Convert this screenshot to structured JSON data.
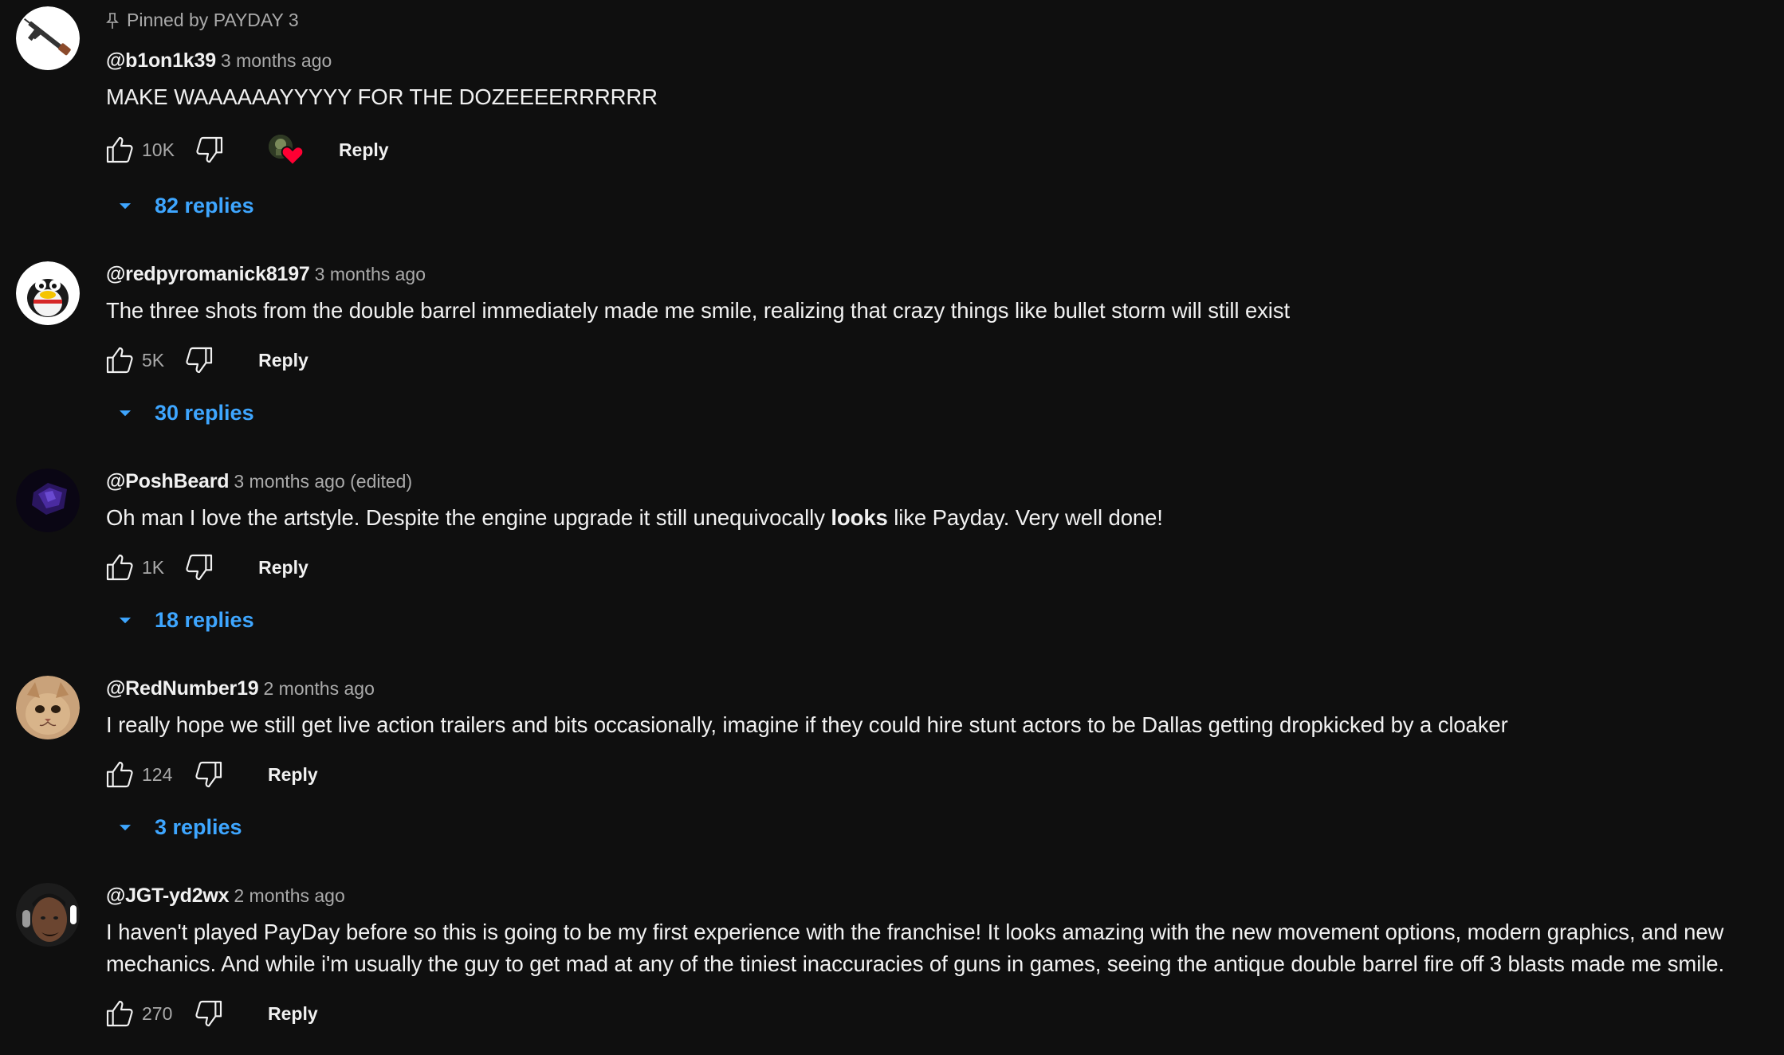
{
  "comments": [
    {
      "pinned_label": "Pinned by PAYDAY 3",
      "author": "@b1on1k39",
      "time": "3 months ago",
      "text": "MAKE WAAAAAAYYYYY FOR THE DOZEEEERRRRRR",
      "likes": "10K",
      "reply_label": "Reply",
      "replies_label": "82 replies",
      "creator_hearted": true,
      "avatar_icon": "rifle-icon"
    },
    {
      "author": "@redpyromanick8197",
      "time": "3 months ago",
      "text": "The three shots from the double barrel immediately made me smile, realizing that crazy things like bullet storm will still exist",
      "likes": "5K",
      "reply_label": "Reply",
      "replies_label": "30 replies",
      "avatar_icon": "penguin-icon"
    },
    {
      "author": "@PoshBeard",
      "time": "3 months ago (edited)",
      "text_before": "Oh man I love the artstyle. Despite the engine upgrade it still unequivocally ",
      "text_bold": "looks",
      "text_after": " like Payday. Very well done!",
      "likes": "1K",
      "reply_label": "Reply",
      "replies_label": "18 replies",
      "avatar_icon": "purple-shape-icon"
    },
    {
      "author": "@RedNumber19",
      "time": "2 months ago",
      "text": "I really hope we still get live action trailers and bits occasionally, imagine if they could hire stunt actors to be Dallas getting dropkicked by a cloaker",
      "likes": "124",
      "reply_label": "Reply",
      "replies_label": "3 replies",
      "avatar_icon": "cat-icon"
    },
    {
      "author": "@JGT-yd2wx",
      "time": "2 months ago",
      "text_line1": "I haven't played PayDay before so this is going to be my first experience with the franchise! It looks amazing with the new movement options, modern graphics, and new",
      "text_line2": "mechanics. And while i'm usually the guy to get mad at any of the tiniest inaccuracies of guns in games, seeing the antique double barrel fire off 3 blasts made me smile.",
      "likes": "270",
      "reply_label": "Reply",
      "avatar_icon": "person-headphones-icon"
    }
  ],
  "colors": {
    "background": "#0f0f0f",
    "text": "#f1f1f1",
    "secondary": "#aaaaaa",
    "link": "#3ea6ff",
    "heart": "#ff0033"
  }
}
